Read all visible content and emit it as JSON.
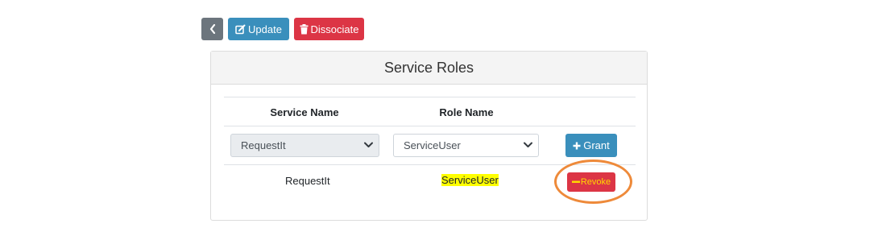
{
  "toolbar": {
    "update_label": "Update",
    "dissociate_label": "Dissociate"
  },
  "card": {
    "title": "Service Roles",
    "columns": [
      "Service Name",
      "Role Name"
    ],
    "form": {
      "service_selected": "RequestIt",
      "role_selected": "ServiceUser",
      "grant_label": "Grant"
    },
    "rows": [
      {
        "service": "RequestIt",
        "role": "ServiceUser",
        "action_label": "Revoke"
      }
    ]
  },
  "colors": {
    "primary": "#3a8fbc",
    "danger": "#dc3545",
    "secondary": "#6c757d",
    "highlight": "#ffff00",
    "annotation": "#ee8a3a"
  }
}
